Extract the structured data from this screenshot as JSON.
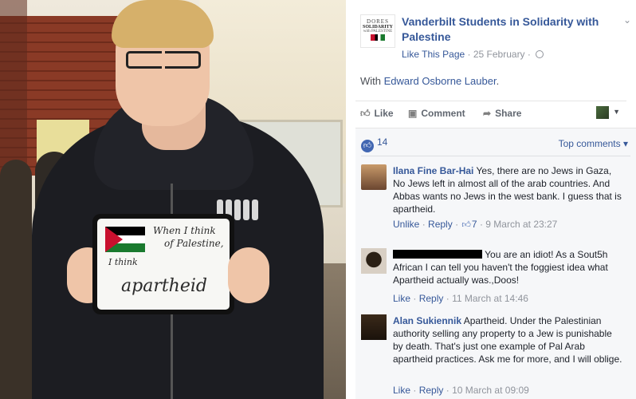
{
  "photo": {
    "board": {
      "line1": "When I think",
      "line2": "of Palestine,",
      "line3": "I think",
      "line4": "apartheid"
    }
  },
  "post": {
    "logo": {
      "line1": "DORES",
      "line2": "SOLIDARITY",
      "line3": "with PALESTINE"
    },
    "page_name": "Vanderbilt Students in Solidarity with Palestine",
    "like_page": "Like This Page",
    "date": "25 February",
    "with_prefix": "With",
    "with_person": "Edward Osborne Lauber",
    "with_suffix": ".",
    "actions": {
      "like": "Like",
      "comment": "Comment",
      "share": "Share"
    },
    "reaction_count": "14",
    "top_comments": "Top comments"
  },
  "comments": [
    {
      "author": "Ilana Fine Bar-Hai",
      "text": "Yes, there are no Jews in Gaza, No Jews left in almost all of the arab countries. And Abbas wants no Jews in the west bank. I guess that is apartheid.",
      "action1": "Unlike",
      "action2": "Reply",
      "likes": "7",
      "time": "9 March at 23:27"
    },
    {
      "author": "",
      "text": "You are an idiot! As a Sout5h African I can tell you haven't the foggiest idea what Apartheid actually was.,Doos!",
      "action1": "Like",
      "action2": "Reply",
      "time": "11 March at 14:46"
    },
    {
      "author": "Alan Sukiennik",
      "text": "Apartheid. Under the Palestinian authority selling any property to a Jew is punishable by death. That's just one example of Pal Arab apartheid practices. Ask me for more, and I will oblige.",
      "action1": "Like",
      "action2": "Reply",
      "time": "10 March at 09:09"
    }
  ],
  "icons": {
    "like": "thumbs-up-icon",
    "comment": "speech-bubble-icon",
    "share": "share-arrow-icon",
    "audience": "globe-icon",
    "menu": "chevron-down-icon"
  },
  "colors": {
    "link": "#365899",
    "muted": "#90949c",
    "panel": "#f6f7f9",
    "like_blue": "#4267b2"
  }
}
